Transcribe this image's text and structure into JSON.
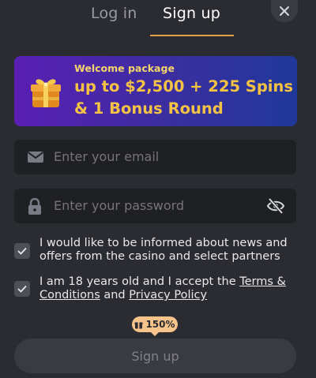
{
  "tabs": {
    "login": "Log in",
    "signup": "Sign up"
  },
  "close_icon": "close-icon",
  "banner": {
    "subtitle": "Welcome package",
    "line1": "up to $2,500 + 225 Spins",
    "line2": "& 1 Bonus Round",
    "icon": "gift-icon"
  },
  "email": {
    "placeholder": "Enter your email",
    "icon": "envelope-icon"
  },
  "password": {
    "placeholder": "Enter your password",
    "icon": "lock-icon",
    "toggle_icon": "eye-off-icon"
  },
  "consent": {
    "news": "I would like to be informed about news and offers from the casino and select partners",
    "age_prefix": "I am 18 years old and I accept the ",
    "terms_link": "Terms & Conditions",
    "and": " and ",
    "privacy_link": "Privacy Policy"
  },
  "bonus_badge": "150%",
  "submit_label": "Sign up",
  "colors": {
    "accent": "#e0a04a",
    "banner_text": "#f4c343",
    "background": "#2b2c31"
  }
}
